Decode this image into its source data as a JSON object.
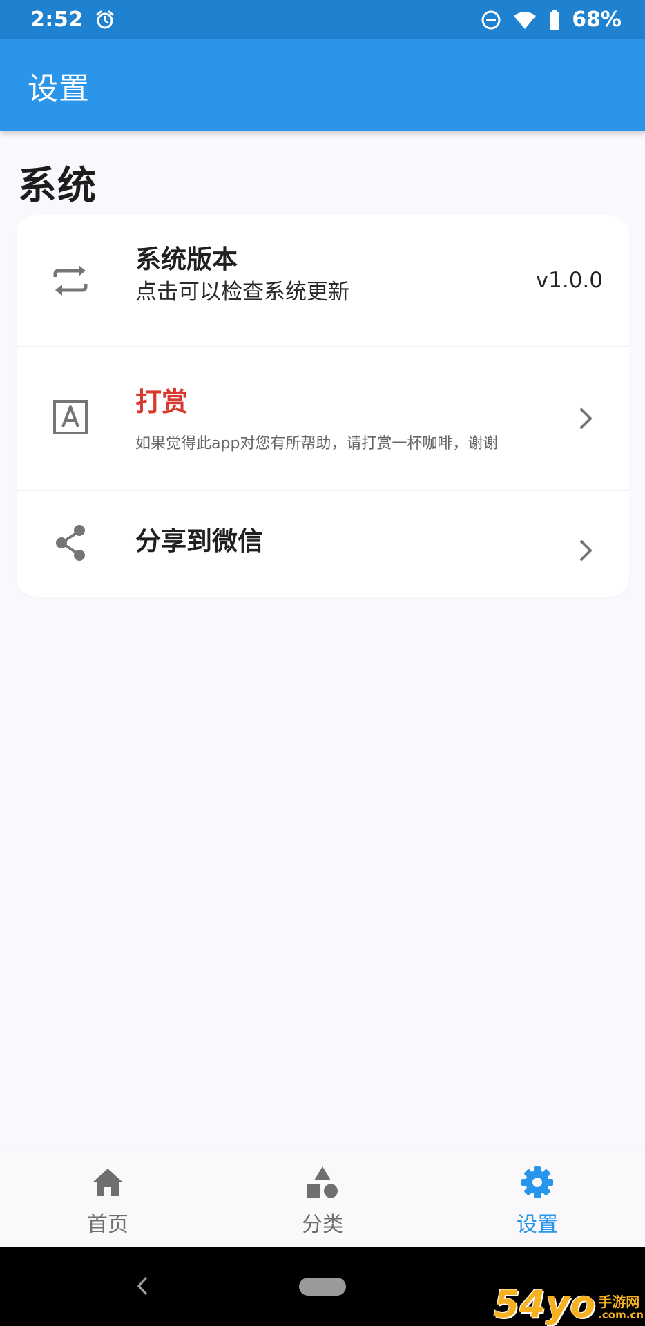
{
  "status_bar": {
    "time": "2:52",
    "battery": "68%",
    "icons": [
      "alarm-icon",
      "do-not-disturb-icon",
      "wifi-icon",
      "battery-icon"
    ]
  },
  "app_bar": {
    "title": "设置"
  },
  "section": {
    "title": "系统"
  },
  "settings": {
    "version": {
      "title": "系统版本",
      "subtitle": "点击可以检查系统更新",
      "value": "v1.0.0",
      "icon": "sync-arrows-icon"
    },
    "reward": {
      "title": "打赏",
      "subtitle": "如果觉得此app对您有所帮助，请打赏一杯咖啡，谢谢",
      "icon": "font-a-icon"
    },
    "share": {
      "title": "分享到微信",
      "icon": "share-icon"
    }
  },
  "bottom_nav": {
    "items": [
      {
        "label": "首页",
        "icon": "home-icon",
        "active": false
      },
      {
        "label": "分类",
        "icon": "category-icon",
        "active": false
      },
      {
        "label": "设置",
        "icon": "gear-icon",
        "active": true
      }
    ]
  },
  "watermark": {
    "logo": "54yo",
    "name": "手游网",
    "url": ".com.cn"
  },
  "colors": {
    "status_bar": "#1f82d0",
    "app_bar": "#2b95ea",
    "accent": "#2796ea",
    "reward_title": "#d63a2f",
    "background": "#faf8fc"
  }
}
